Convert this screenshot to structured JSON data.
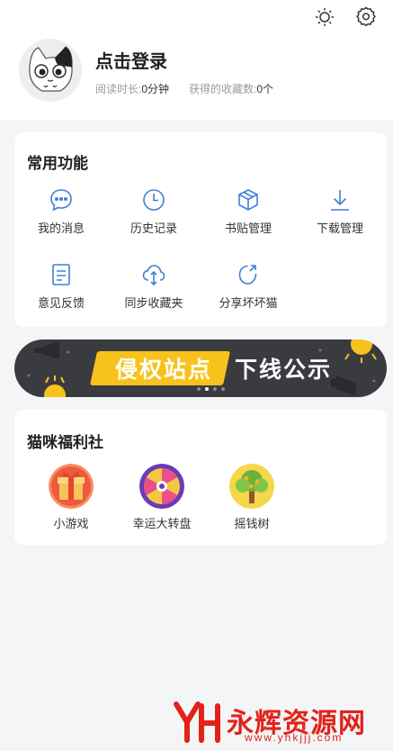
{
  "profile": {
    "login_label": "点击登录",
    "reading_time_label": "阅读时长:",
    "reading_time_value": "0分钟",
    "favorites_label": "获得的收藏数:",
    "favorites_value": "0个"
  },
  "top_icons": [
    "sun-icon",
    "gear-icon"
  ],
  "common_functions": {
    "title": "常用功能",
    "items": [
      {
        "label": "我的消息",
        "icon": "message-icon"
      },
      {
        "label": "历史记录",
        "icon": "clock-icon"
      },
      {
        "label": "书贴管理",
        "icon": "box-icon"
      },
      {
        "label": "下载管理",
        "icon": "download-icon"
      },
      {
        "label": "意见反馈",
        "icon": "document-icon"
      },
      {
        "label": "同步收藏夹",
        "icon": "cloud-sync-icon"
      },
      {
        "label": "分享坏坏猫",
        "icon": "share-icon"
      }
    ]
  },
  "banner": {
    "text_highlight": "侵权站点",
    "text_rest": "下线公示"
  },
  "welfare": {
    "title": "猫咪福利社",
    "items": [
      {
        "label": "小游戏",
        "icon": "gift-box-icon"
      },
      {
        "label": "幸运大转盘",
        "icon": "wheel-icon"
      },
      {
        "label": "摇钱树",
        "icon": "money-tree-icon"
      }
    ]
  },
  "watermark": {
    "main": "永辉资源网",
    "sub": "www.yhkjjj.com"
  },
  "colors": {
    "accent_blue": "#3f7fd8",
    "banner_yellow": "#f7c21c",
    "banner_dark": "#3a3b3f",
    "watermark_red": "#e2231a"
  }
}
